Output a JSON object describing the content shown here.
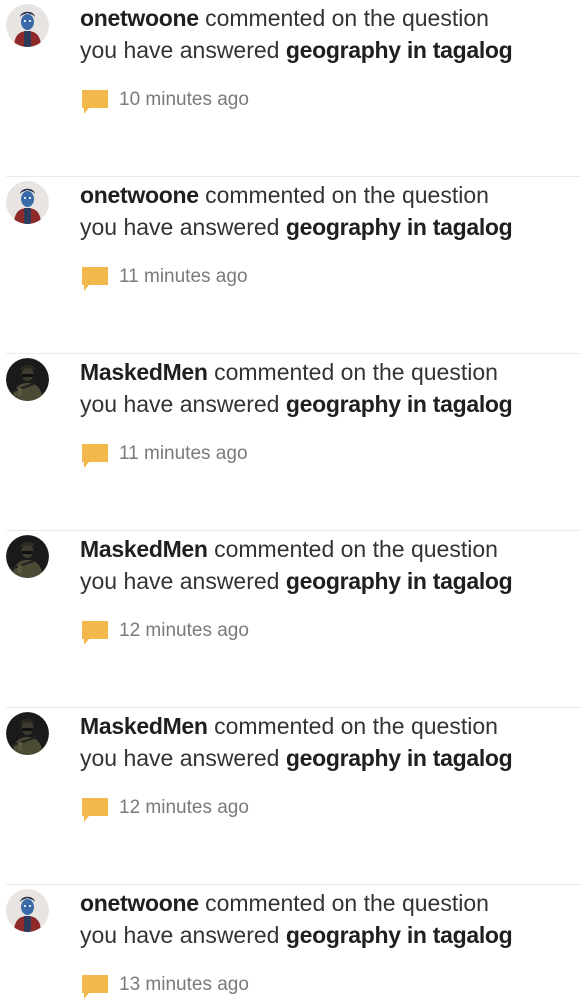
{
  "notifications": [
    {
      "user": "onetwoone",
      "avatar_icon": "user-avatar-icon",
      "line1_text": "commented on the question",
      "line2_text": "you have answered",
      "question": "geography in tagalog",
      "time": "10 minutes ago",
      "comment_icon": "speech-bubble-icon"
    },
    {
      "user": "onetwoone",
      "avatar_icon": "user-avatar-icon",
      "line1_text": "commented on the question",
      "line2_text": "you have answered",
      "question": "geography in tagalog",
      "time": "11 minutes ago",
      "comment_icon": "speech-bubble-icon"
    },
    {
      "user": "MaskedMen",
      "avatar_icon": "soldier-avatar-icon",
      "line1_text": "commented on the question",
      "line2_text": "you have answered",
      "question": "geography in tagalog",
      "time": "11 minutes ago",
      "comment_icon": "speech-bubble-icon"
    },
    {
      "user": "MaskedMen",
      "avatar_icon": "soldier-avatar-icon",
      "line1_text": "commented on the question",
      "line2_text": "you have answered",
      "question": "geography in tagalog",
      "time": "12 minutes ago",
      "comment_icon": "speech-bubble-icon"
    },
    {
      "user": "MaskedMen",
      "avatar_icon": "soldier-avatar-icon",
      "line1_text": "commented on the question",
      "line2_text": "you have answered",
      "question": "geography in tagalog",
      "time": "12 minutes ago",
      "comment_icon": "speech-bubble-icon"
    },
    {
      "user": "onetwoone",
      "avatar_icon": "user-avatar-icon",
      "line1_text": "commented on the question",
      "line2_text": "you have answered",
      "question": "geography in tagalog",
      "time": "13 minutes ago",
      "comment_icon": "speech-bubble-icon"
    }
  ],
  "colors": {
    "comment_icon": "#f2b84b",
    "divider": "#ebebeb",
    "timestamp": "#7a7a7a"
  }
}
